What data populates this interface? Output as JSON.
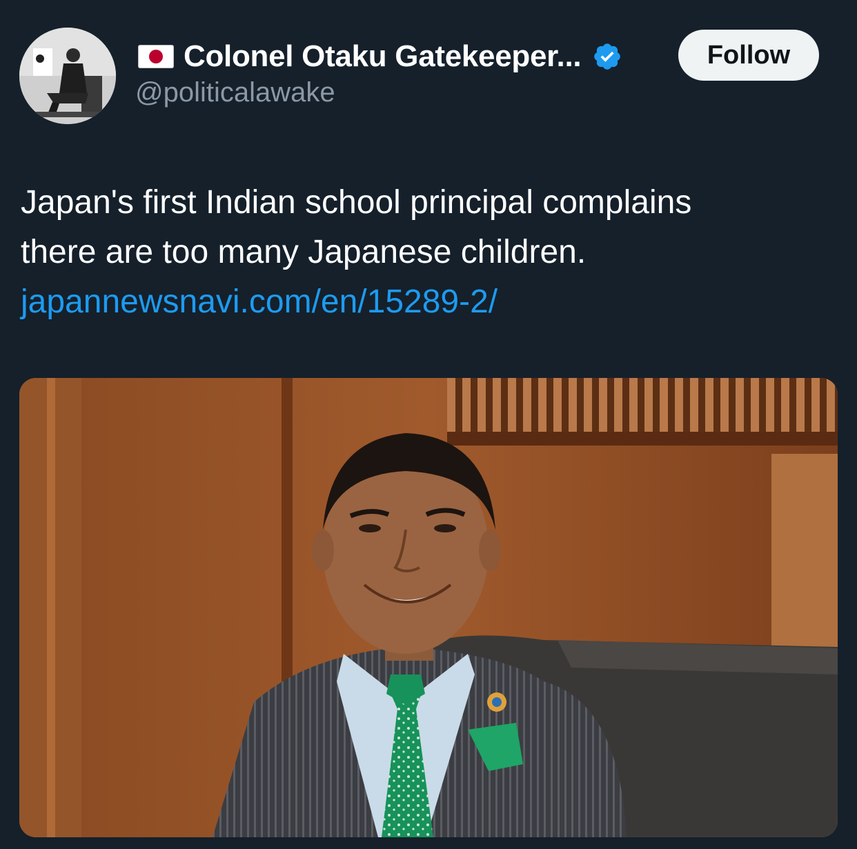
{
  "colors": {
    "background": "#15202b",
    "text_primary": "#ffffff",
    "text_secondary": "#8b98a5",
    "link": "#1d9bf0",
    "verified_badge": "#1d9bf0",
    "follow_button_bg": "#eff3f4",
    "follow_button_text": "#0f1419"
  },
  "author": {
    "avatar_icon": "profile-avatar",
    "flag_icon": "japan-flag-icon",
    "display_name": "Colonel Otaku Gatekeeper...",
    "verified_icon": "verified-badge-icon",
    "handle": "@politicalawake"
  },
  "follow_button": {
    "label": "Follow"
  },
  "tweet": {
    "text_lines": [
      "Japan's first Indian school principal complains",
      "there are too many Japanese children."
    ],
    "link": "japannewsnavi.com/en/15289-2/"
  },
  "media": {
    "icon": "photo-man-in-suit-smiling"
  }
}
